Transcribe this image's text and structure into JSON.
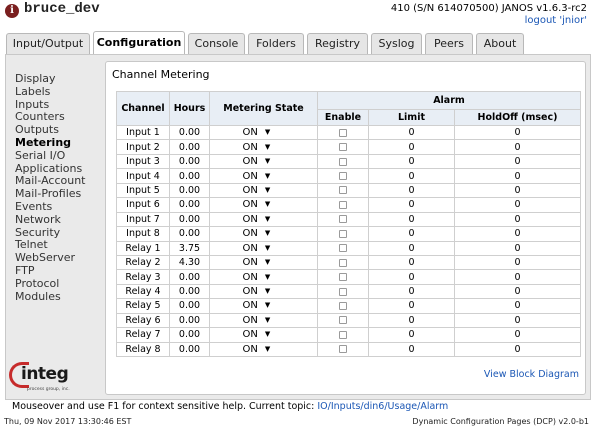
{
  "header": {
    "hostname": "bruce_dev",
    "device_info": "410 (S/N 614070500) JANOS v1.6.3-rc2",
    "logout": "logout 'jnior'"
  },
  "tabs": [
    {
      "label": "Input/Output",
      "active": false
    },
    {
      "label": "Configuration",
      "active": true
    },
    {
      "label": "Console",
      "active": false
    },
    {
      "label": "Folders",
      "active": false
    },
    {
      "label": "Registry",
      "active": false
    },
    {
      "label": "Syslog",
      "active": false
    },
    {
      "label": "Peers",
      "active": false
    },
    {
      "label": "About",
      "active": false
    }
  ],
  "sidebar": {
    "items": [
      {
        "label": "Display",
        "active": false
      },
      {
        "label": "Labels",
        "active": false
      },
      {
        "label": "Inputs",
        "active": false
      },
      {
        "label": "Counters",
        "active": false
      },
      {
        "label": "Outputs",
        "active": false
      },
      {
        "label": "Metering",
        "active": true
      },
      {
        "label": "Serial I/O",
        "active": false
      },
      {
        "label": "Applications",
        "active": false
      },
      {
        "label": "Mail-Account",
        "active": false
      },
      {
        "label": "Mail-Profiles",
        "active": false
      },
      {
        "label": "Events",
        "active": false
      },
      {
        "label": "Network",
        "active": false
      },
      {
        "label": "Security",
        "active": false
      },
      {
        "label": "Telnet",
        "active": false
      },
      {
        "label": "WebServer",
        "active": false
      },
      {
        "label": "FTP",
        "active": false
      },
      {
        "label": "Protocol",
        "active": false
      },
      {
        "label": "Modules",
        "active": false
      }
    ]
  },
  "logo": {
    "text": "integ",
    "subtext": "process group, inc."
  },
  "main": {
    "title": "Channel Metering",
    "columns": {
      "channel": "Channel",
      "hours": "Hours",
      "state": "Metering State",
      "alarm": "Alarm",
      "enable": "Enable",
      "limit": "Limit",
      "holdoff": "HoldOff (msec)"
    },
    "rows": [
      {
        "channel": "Input 1",
        "hours": "0.00",
        "state": "ON",
        "enabled": false,
        "limit": "0",
        "holdoff": "0"
      },
      {
        "channel": "Input 2",
        "hours": "0.00",
        "state": "ON",
        "enabled": false,
        "limit": "0",
        "holdoff": "0"
      },
      {
        "channel": "Input 3",
        "hours": "0.00",
        "state": "ON",
        "enabled": false,
        "limit": "0",
        "holdoff": "0"
      },
      {
        "channel": "Input 4",
        "hours": "0.00",
        "state": "ON",
        "enabled": false,
        "limit": "0",
        "holdoff": "0"
      },
      {
        "channel": "Input 5",
        "hours": "0.00",
        "state": "ON",
        "enabled": false,
        "limit": "0",
        "holdoff": "0"
      },
      {
        "channel": "Input 6",
        "hours": "0.00",
        "state": "ON",
        "enabled": false,
        "limit": "0",
        "holdoff": "0"
      },
      {
        "channel": "Input 7",
        "hours": "0.00",
        "state": "ON",
        "enabled": false,
        "limit": "0",
        "holdoff": "0"
      },
      {
        "channel": "Input 8",
        "hours": "0.00",
        "state": "ON",
        "enabled": false,
        "limit": "0",
        "holdoff": "0"
      },
      {
        "channel": "Relay 1",
        "hours": "3.75",
        "state": "ON",
        "enabled": false,
        "limit": "0",
        "holdoff": "0"
      },
      {
        "channel": "Relay 2",
        "hours": "4.30",
        "state": "ON",
        "enabled": false,
        "limit": "0",
        "holdoff": "0"
      },
      {
        "channel": "Relay 3",
        "hours": "0.00",
        "state": "ON",
        "enabled": false,
        "limit": "0",
        "holdoff": "0"
      },
      {
        "channel": "Relay 4",
        "hours": "0.00",
        "state": "ON",
        "enabled": false,
        "limit": "0",
        "holdoff": "0"
      },
      {
        "channel": "Relay 5",
        "hours": "0.00",
        "state": "ON",
        "enabled": false,
        "limit": "0",
        "holdoff": "0"
      },
      {
        "channel": "Relay 6",
        "hours": "0.00",
        "state": "ON",
        "enabled": false,
        "limit": "0",
        "holdoff": "0"
      },
      {
        "channel": "Relay 7",
        "hours": "0.00",
        "state": "ON",
        "enabled": false,
        "limit": "0",
        "holdoff": "0"
      },
      {
        "channel": "Relay 8",
        "hours": "0.00",
        "state": "ON",
        "enabled": false,
        "limit": "0",
        "holdoff": "0"
      }
    ],
    "view_block_diagram": "View Block Diagram"
  },
  "help": {
    "text": "Mouseover and use F1 for context sensitive help. Current topic: ",
    "topic": "IO/Inputs/din6/Usage/Alarm"
  },
  "status": {
    "datetime": "Thu, 09 Nov 2017 13:30:46 EST",
    "version": "Dynamic Configuration Pages (DCP) v2.0-b1"
  },
  "colors": {
    "link": "#1b57b5",
    "header_bg": "#e8eef5",
    "logo_red": "#c62b2b",
    "brand_mark": "#7a1f1f"
  }
}
